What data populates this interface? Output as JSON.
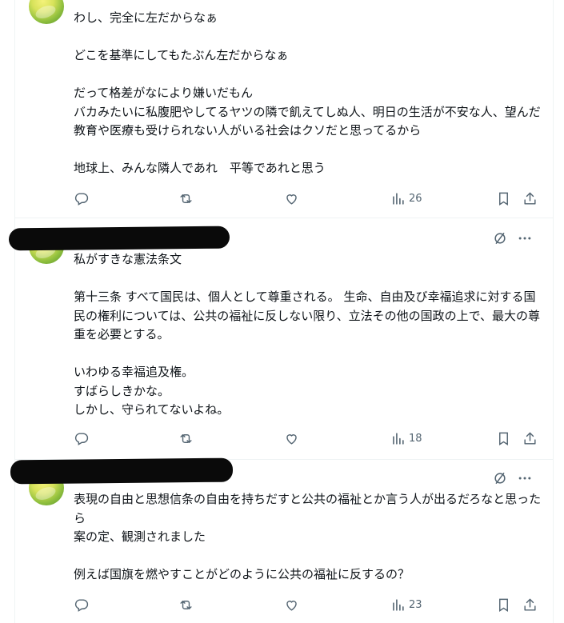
{
  "posts": [
    {
      "text": "わし、完全に左だからなぁ\n\nどこを基準にしてもたぶん左だからなぁ\n\nだって格差がなにより嫌いだもん\nバカみたいに私腹肥やしてるヤツの隣で飢えてしぬ人、明日の生活が不安な人、望んだ教育や医療も受けられない人がいる社会はクソだと思ってるから\n\n地球上、みんな隣人であれ　平等であれと思う",
      "views": "26"
    },
    {
      "text": "私がすきな憲法条文\n\n第十三条 すべて国民は、個人として尊重される。 生命、自由及び幸福追求に対する国民の権利については、公共の福祉に反しない限り、立法その他の国政の上で、最大の尊重を必要とする。\n\nいわゆる幸福追及権。\nすばらしきかな。\nしかし、守られてないよね。",
      "views": "18"
    },
    {
      "text": "表現の自由と思想信条の自由を持ちだすと公共の福祉とか言う人が出るだろなと思ったら\n案の定、観測されました\n\n例えば国旗を燃やすことがどのように公共の福祉に反するの？",
      "views": "23"
    }
  ],
  "icons": {
    "reply": "reply-icon",
    "repost": "repost-icon",
    "like": "like-icon",
    "views": "views-icon",
    "bookmark": "bookmark-icon",
    "share": "share-icon",
    "grok": "grok-icon",
    "more": "more-icon"
  },
  "colors": {
    "icon": "#536471",
    "text": "#0f1419",
    "border": "#eff3f4"
  }
}
